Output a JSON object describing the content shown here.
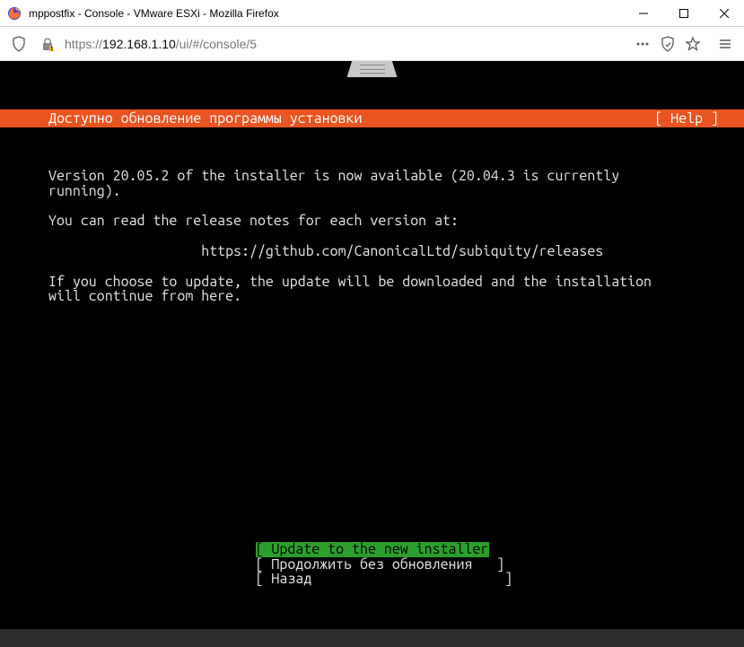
{
  "window": {
    "title": "mppostfix - Console - VMware ESXi - Mozilla Firefox"
  },
  "addressbar": {
    "url_prefix": "https://",
    "url_host": "192.168.1.10",
    "url_path": "/ui/#/console/5"
  },
  "installer": {
    "header_title": "Доступно обновление программы установки",
    "help_label": "[ Help ]",
    "line1": "Version 20.05.2 of the installer is now available (20.04.3 is currently",
    "line2": "running).",
    "line3": "You can read the release notes for each version at:",
    "line4": "https://github.com/CanonicalLtd/subiquity/releases",
    "line5": "If you choose to update, the update will be downloaded and the installation",
    "line6": "will continue from here.",
    "menu": {
      "option1": "[ Update to the new installer ]",
      "option2": "[ Продолжить без обновления   ]",
      "option3": "[ Назад                        ]"
    }
  }
}
